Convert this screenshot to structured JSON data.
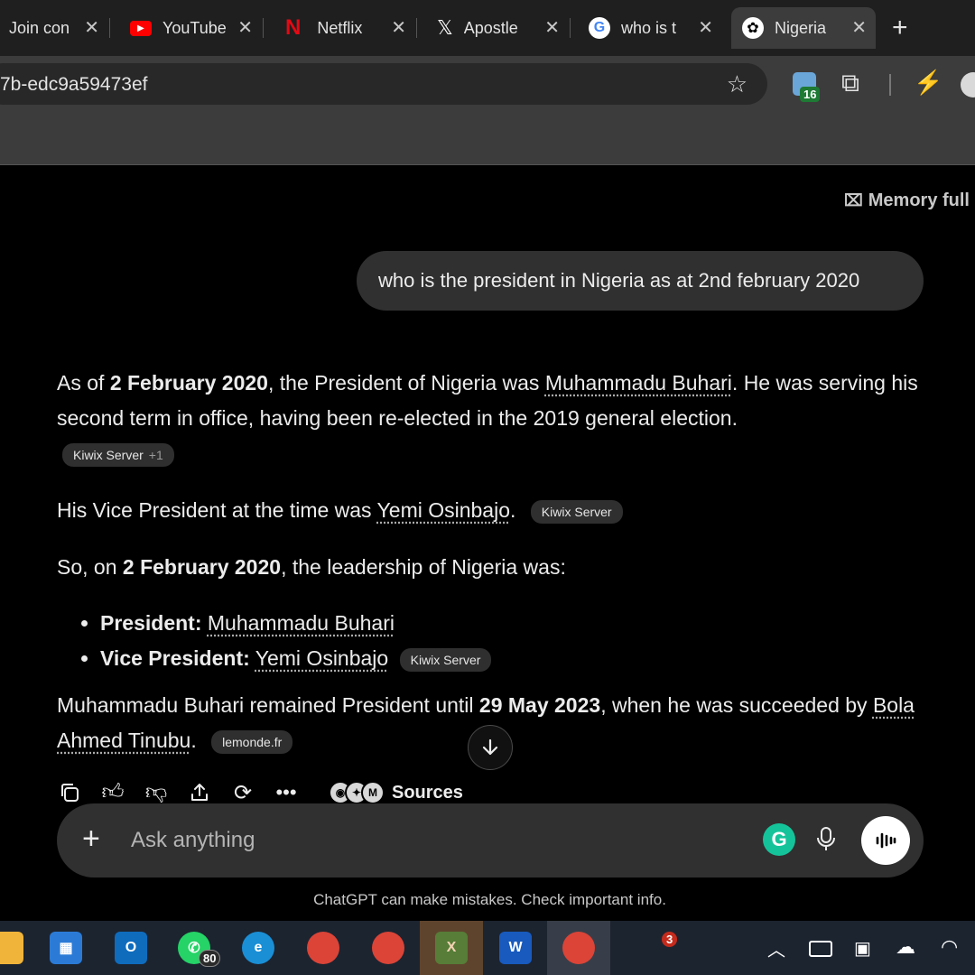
{
  "browser": {
    "tabs": [
      {
        "title": "Join con",
        "icon": "tab-icon"
      },
      {
        "title": "YouTube",
        "icon": "youtube-icon"
      },
      {
        "title": "Netflix",
        "icon": "netflix-icon"
      },
      {
        "title": "Apostle",
        "icon": "x-icon"
      },
      {
        "title": "who is t",
        "icon": "google-icon"
      },
      {
        "title": "Nigeria",
        "icon": "chatgpt-icon",
        "active": true
      }
    ],
    "url": "7b-edc9a59473ef",
    "extensions_badge": "16"
  },
  "chat": {
    "memory_label": "Memory full",
    "user_message": "who is the president in Nigeria as at 2nd february 2020",
    "p1": {
      "t1": "As of ",
      "b1": "2 February 2020",
      "t2": ", the President of Nigeria was ",
      "link1": "Muhammadu Buhari",
      "t3": ". He was serving his second term in office, having been re-elected in the 2019 general election."
    },
    "p1_source": {
      "label": "Kiwix Server",
      "extra": "+1"
    },
    "p2": {
      "t1": "His Vice President at the time was ",
      "link1": "Yemi Osinbajo",
      "t2": ".",
      "source": "Kiwix Server"
    },
    "p3": {
      "t1": "So, on ",
      "b1": "2 February 2020",
      "t2": ", the leadership of Nigeria was:"
    },
    "list": [
      {
        "label": "President:",
        "value": "Muhammadu Buhari"
      },
      {
        "label": "Vice President:",
        "value": "Yemi Osinbajo",
        "source": "Kiwix Server"
      }
    ],
    "p4": {
      "t1": "Muhammadu Buhari remained President until ",
      "b1": "29 May 2023",
      "t2": ", when he was succeeded by ",
      "link1": "Bola Ahmed Tinubu",
      "t3": ".",
      "source": "lemonde.fr"
    },
    "sources_label": "Sources",
    "composer_placeholder": "Ask anything",
    "disclaimer": "ChatGPT can make mistakes. Check important info."
  },
  "taskbar": {
    "whatsapp_badge": "80",
    "notification_badge": "3"
  },
  "colors": {
    "background": "#000000",
    "bubble": "#303030",
    "grammarly": "#15c39a",
    "accent_green": "#2ea043"
  }
}
